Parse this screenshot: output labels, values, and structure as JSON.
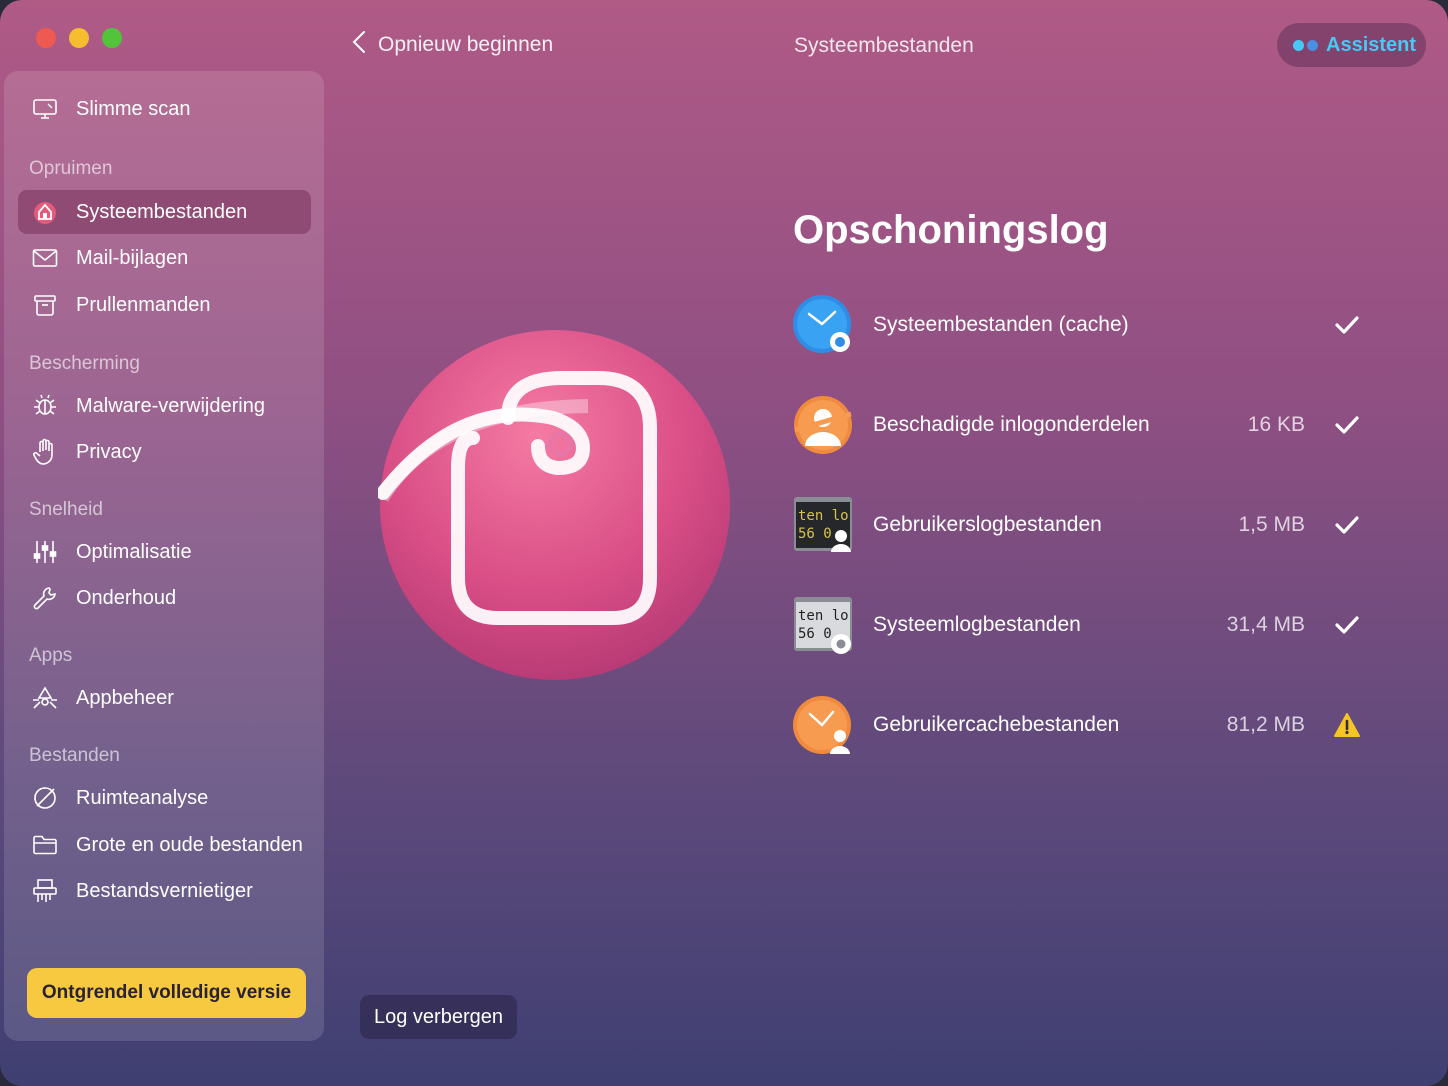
{
  "window": {
    "title": "Systeembestanden",
    "back_label": "Opnieuw beginnen",
    "assistant_label": "Assistent"
  },
  "sidebar": {
    "smart_scan": "Slimme scan",
    "sections": [
      {
        "title": "Opruimen",
        "items": [
          "Systeembestanden",
          "Mail-bijlagen",
          "Prullenmanden"
        ]
      },
      {
        "title": "Bescherming",
        "items": [
          "Malware-verwijdering",
          "Privacy"
        ]
      },
      {
        "title": "Snelheid",
        "items": [
          "Optimalisatie",
          "Onderhoud"
        ]
      },
      {
        "title": "Apps",
        "items": [
          "Appbeheer"
        ]
      },
      {
        "title": "Bestanden",
        "items": [
          "Ruimteanalyse",
          "Grote en oude bestanden",
          "Bestandsvernietiger"
        ]
      }
    ],
    "active_item": "Systeembestanden",
    "unlock_label": "Ontgrendel volledige versie"
  },
  "log": {
    "heading": "Opschoningslog",
    "entries": [
      {
        "name": "Systeembestanden (cache)",
        "size": "",
        "status": "done",
        "icon": "blue-clock-gear-icon"
      },
      {
        "name": "Beschadigde inlogonderdelen",
        "size": "16 KB",
        "status": "done",
        "icon": "broken-user-icon"
      },
      {
        "name": "Gebruikerslogbestanden",
        "size": "1,5 MB",
        "status": "done",
        "icon": "terminal-user-icon"
      },
      {
        "name": "Systeemlogbestanden",
        "size": "31,4 MB",
        "status": "done",
        "icon": "terminal-gear-icon"
      },
      {
        "name": "Gebruikercachebestanden",
        "size": "81,2 MB",
        "status": "warning",
        "icon": "orange-clock-user-icon"
      }
    ],
    "hide_label": "Log verbergen"
  },
  "colors": {
    "accent_blue": "#47c8f5",
    "unlock_yellow": "#f7c940",
    "warning_yellow": "#f5c524"
  }
}
